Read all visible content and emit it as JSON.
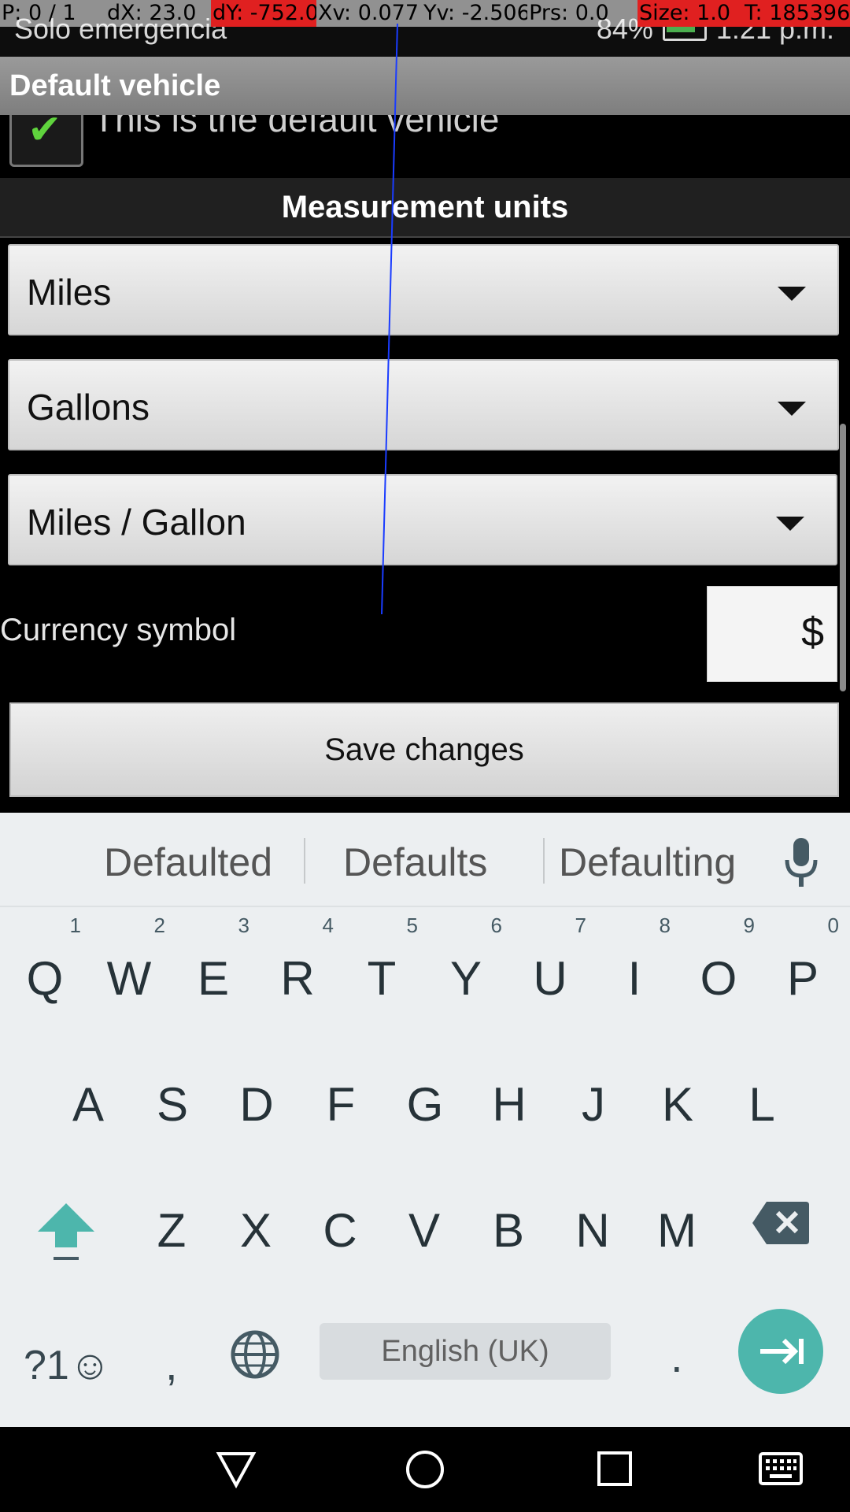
{
  "status_bar": {
    "carrier": "Solo emergencia",
    "battery": "84%",
    "time": "1:21 p.m."
  },
  "debug_overlay": {
    "p": "P: 0 / 1",
    "dx": "dX: 23.0",
    "dy": "dY: -752.0",
    "xv": "Xv: 0.077",
    "yv": "Yv: -2.506",
    "prs": "Prs: 0.0",
    "size": "Size: 1.0",
    "t": "T: 185396"
  },
  "title_bar": {
    "title": "Default vehicle"
  },
  "default_checkbox": {
    "label": "This is the default vehicle",
    "checked": true
  },
  "section": {
    "title": "Measurement units"
  },
  "spinners": {
    "distance": "Miles",
    "volume": "Gallons",
    "consumption": "Miles / Gallon"
  },
  "currency": {
    "label": "Currency symbol",
    "value": "$"
  },
  "save_button": {
    "label": "Save changes"
  },
  "keyboard": {
    "suggestions": [
      "Defaulted",
      "Defaults",
      "Defaulting"
    ],
    "row1": [
      {
        "k": "Q",
        "h": "1"
      },
      {
        "k": "W",
        "h": "2"
      },
      {
        "k": "E",
        "h": "3"
      },
      {
        "k": "R",
        "h": "4"
      },
      {
        "k": "T",
        "h": "5"
      },
      {
        "k": "Y",
        "h": "6"
      },
      {
        "k": "U",
        "h": "7"
      },
      {
        "k": "I",
        "h": "8"
      },
      {
        "k": "O",
        "h": "9"
      },
      {
        "k": "P",
        "h": "0"
      }
    ],
    "row2": [
      "A",
      "S",
      "D",
      "F",
      "G",
      "H",
      "J",
      "K",
      "L"
    ],
    "row3": [
      "Z",
      "X",
      "C",
      "V",
      "B",
      "N",
      "M"
    ],
    "symbols_key": "?1☺",
    "comma": ",",
    "period": ".",
    "space_label": "English (UK)"
  },
  "colors": {
    "accent": "#4db6ac",
    "debug_red": "#e02020",
    "trace_blue": "#1a3cff"
  }
}
